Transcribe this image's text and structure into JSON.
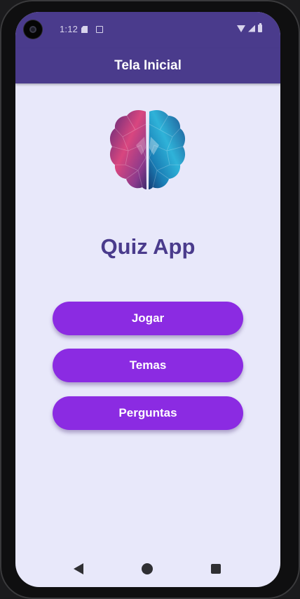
{
  "status_bar": {
    "time": "1:12",
    "icons": [
      "sd-card-icon",
      "cast-icon",
      "wifi-icon",
      "signal-icon",
      "battery-icon"
    ]
  },
  "app_bar": {
    "title": "Tela Inicial",
    "color": "#4a3b8c"
  },
  "main": {
    "logo_icon": "brain-icon",
    "title": "Quiz App",
    "buttons": [
      {
        "label": "Jogar"
      },
      {
        "label": "Temas"
      },
      {
        "label": "Perguntas"
      }
    ],
    "button_color": "#8b2be2",
    "background_color": "#e8e8fa"
  },
  "navigation_bar": {
    "icons": [
      "back-icon",
      "home-icon",
      "recents-icon"
    ]
  }
}
